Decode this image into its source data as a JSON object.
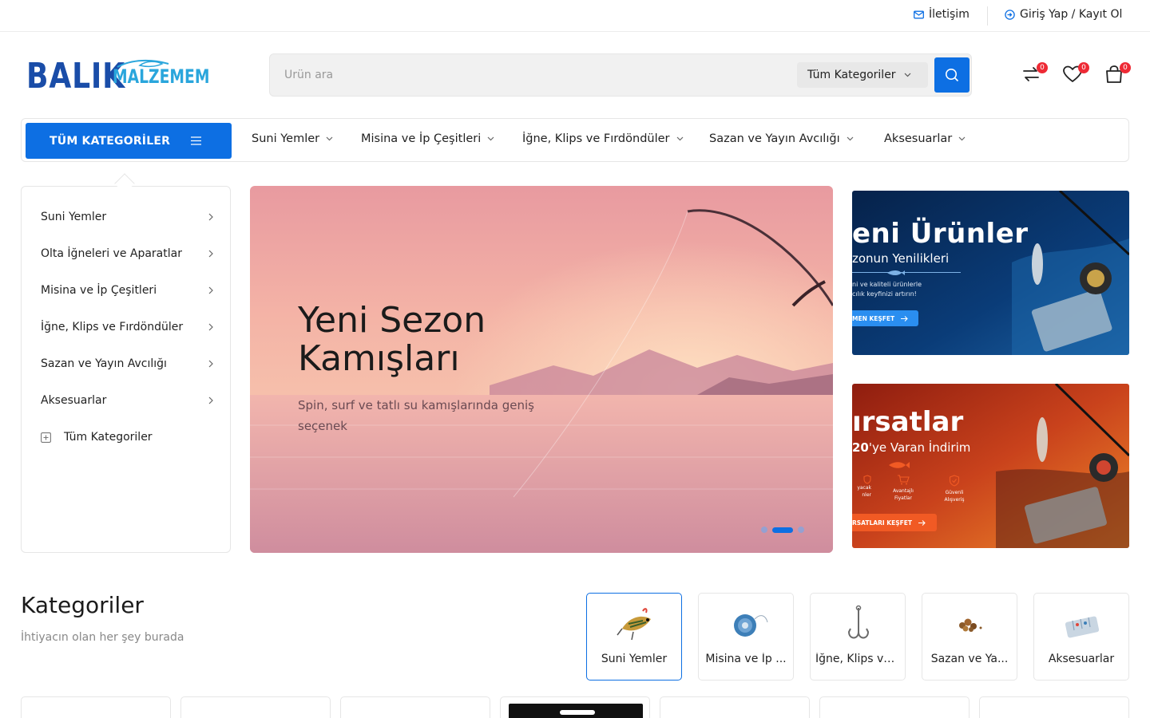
{
  "topbar": {
    "contact_label": "İletişim",
    "login_label": "Giriş Yap / Kayıt Ol"
  },
  "logo": {
    "part1": "BALIK",
    "part2": "MALZEMEM"
  },
  "search": {
    "placeholder": "Ürün ara",
    "category_label": "Tüm Kategoriler"
  },
  "header_icons": {
    "compare_count": "0",
    "wishlist_count": "0",
    "cart_count": "0"
  },
  "nav": {
    "all_categories_label": "TÜM KATEGORİLER",
    "items": [
      {
        "label": "Suni Yemler"
      },
      {
        "label": "Misina ve İp Çeşitleri"
      },
      {
        "label": "İğne, Klips ve Fırdöndüler"
      },
      {
        "label": "Sazan ve Yayın Avcılığı"
      },
      {
        "label": "Aksesuarlar"
      }
    ]
  },
  "sidebar": {
    "items": [
      {
        "label": "Suni Yemler"
      },
      {
        "label": "Olta İğneleri ve Aparatlar"
      },
      {
        "label": "Misina ve İp Çeşitleri"
      },
      {
        "label": "İğne, Klips ve Fırdöndüler"
      },
      {
        "label": "Sazan ve Yayın Avcılığı"
      },
      {
        "label": "Aksesuarlar"
      }
    ],
    "all_label": "Tüm Kategoriler"
  },
  "hero": {
    "title": "Yeni Sezon Kamışları",
    "subtitle": "Spin, surf ve tatlı su kamışlarında geniş seçenek",
    "active_slide": 2,
    "slide_count": 3
  },
  "banner1": {
    "title": "eni Ürünler",
    "subtitle": "zonun Yenilikleri",
    "text_line1": "ni ve kaliteli ürünlerle",
    "text_line2": "cılık keyfinizi artırın!",
    "button": "MEN KEŞFET"
  },
  "banner2": {
    "title": "ırsatlar",
    "subtitle_bold": "20",
    "subtitle_rest": "'ye Varan İndirim",
    "features": [
      {
        "line1": "yacak",
        "line2": "nler"
      },
      {
        "line1": "Avantajlı",
        "line2": "Fiyatlar"
      },
      {
        "line1": "Güvenli",
        "line2": "Alışveriş"
      }
    ],
    "button": "RSATLARI KEŞFET"
  },
  "categories": {
    "heading": "Kategoriler",
    "subheading": "İhtiyacın olan her şey burada",
    "cards": [
      {
        "label": "Suni Yemler",
        "icon": "lure-icon"
      },
      {
        "label": "Misina ve İp ...",
        "icon": "fishing-line-icon"
      },
      {
        "label": "İğne, Klips ve...",
        "icon": "hook-icon"
      },
      {
        "label": "Sazan ve Ya...",
        "icon": "bait-icon"
      },
      {
        "label": "Aksesuarlar",
        "icon": "tackle-box-icon"
      }
    ]
  },
  "colors": {
    "primary": "#0d6fe3",
    "badge": "#ee2a35",
    "logo_dark": "#1a4da8",
    "logo_light": "#2aa6dc",
    "promo_orange": "#f15a24"
  }
}
